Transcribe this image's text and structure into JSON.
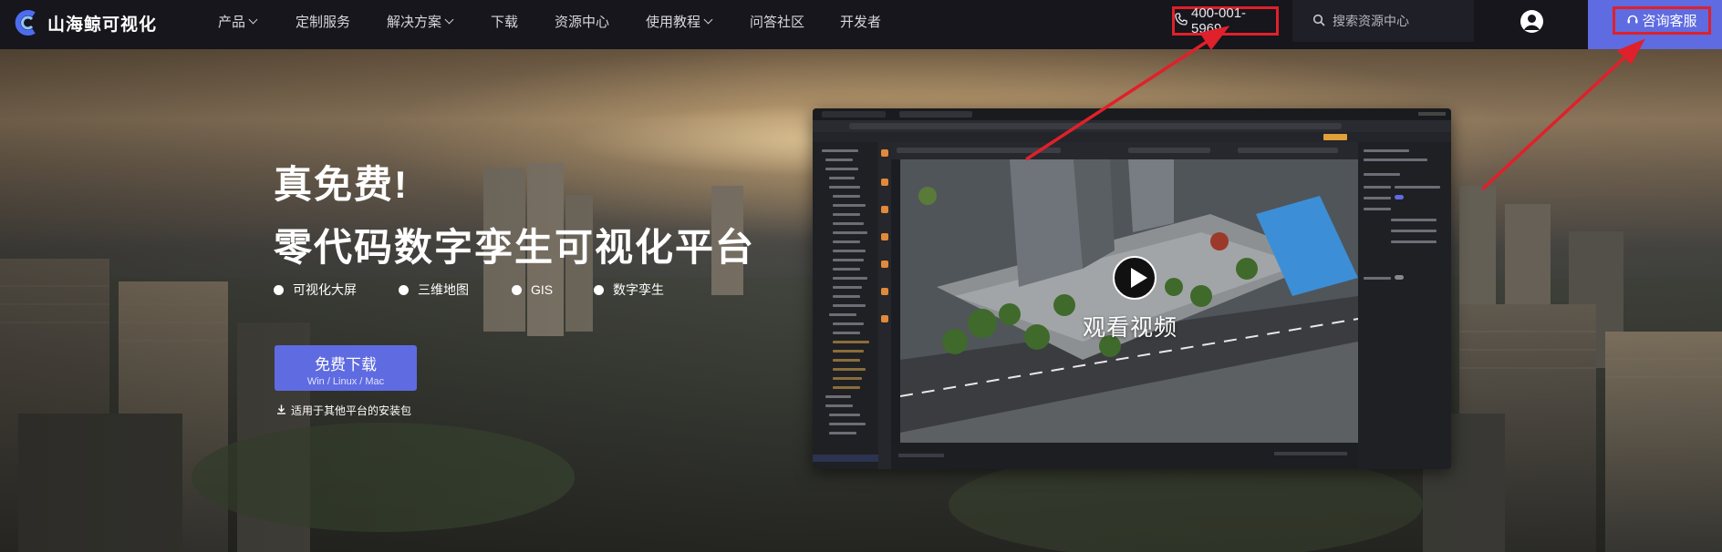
{
  "header": {
    "brand": "山海鲸可视化",
    "nav": [
      {
        "label": "产品",
        "dropdown": true
      },
      {
        "label": "定制服务",
        "dropdown": false
      },
      {
        "label": "解决方案",
        "dropdown": true
      },
      {
        "label": "下载",
        "dropdown": false
      },
      {
        "label": "资源中心",
        "dropdown": false
      },
      {
        "label": "使用教程",
        "dropdown": true
      },
      {
        "label": "问答社区",
        "dropdown": false
      },
      {
        "label": "开发者",
        "dropdown": false
      }
    ],
    "phone": "400-001-5969",
    "search_placeholder": "搜索资源中心",
    "consult_label": "咨询客服"
  },
  "hero": {
    "title_line1": "真免费!",
    "title_line2": "零代码数字孪生可视化平台",
    "features": [
      "可视化大屏",
      "三维地图",
      "GIS",
      "数字孪生"
    ],
    "download_label": "免费下载",
    "download_platforms": "Win / Linux / Mac",
    "other_platforms_label": "适用于其他平台的安装包"
  },
  "video": {
    "watch_label": "观看视频"
  },
  "colors": {
    "accent": "#5f6be0",
    "annotation_red": "#e0202a",
    "nav_bg": "#16161c"
  },
  "icons": [
    "logo-icon",
    "phone-icon",
    "search-icon",
    "user-icon",
    "headset-icon",
    "download-icon",
    "play-icon"
  ]
}
